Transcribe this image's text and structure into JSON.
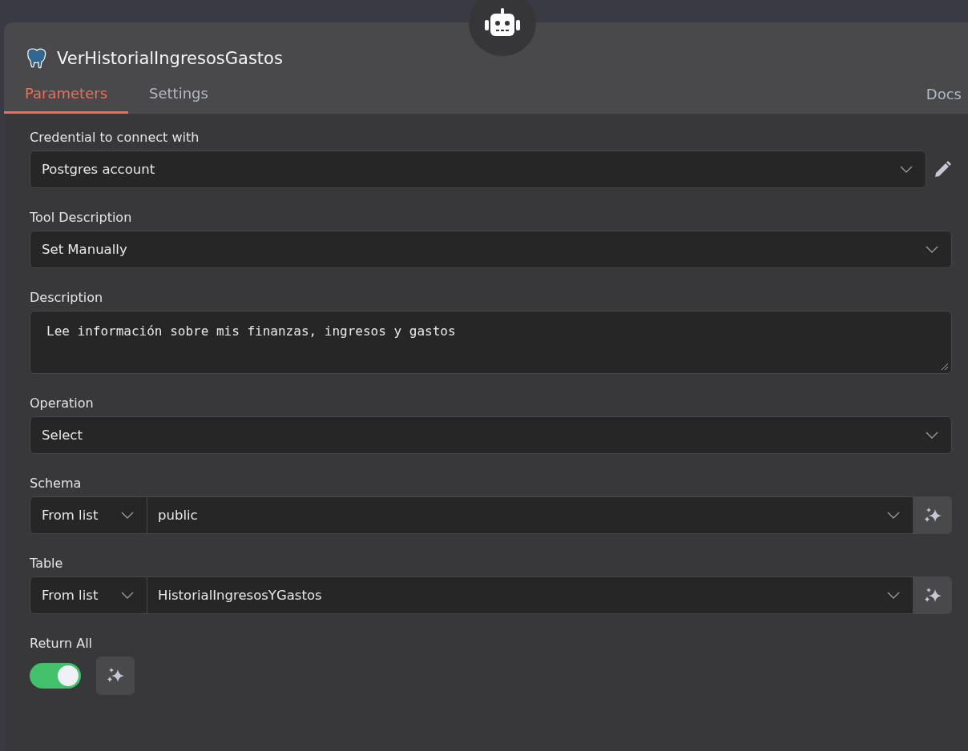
{
  "node": {
    "title": "VerHistorialIngresosGastos"
  },
  "tabs": [
    {
      "label": "Parameters",
      "selected": true
    },
    {
      "label": "Settings",
      "selected": false
    }
  ],
  "docs_link": "Docs",
  "parameters": [
    {
      "kind": "select",
      "label": "Credential to connect with",
      "value": "Postgres account",
      "editable": true
    },
    {
      "kind": "select",
      "label": "Tool Description",
      "value": "Set Manually",
      "editable": false
    },
    {
      "kind": "textarea",
      "label": "Description",
      "value": "Lee información sobre mis finanzas, ingresos y gastos"
    },
    {
      "kind": "select",
      "label": "Operation",
      "value": "Select",
      "editable": false
    },
    {
      "kind": "locator",
      "label": "Schema",
      "mode": "From list",
      "value": "public"
    },
    {
      "kind": "locator",
      "label": "Table",
      "mode": "From list",
      "value": "HistorialIngresosYGastos"
    },
    {
      "kind": "toggle",
      "label": "Return All",
      "on": true
    }
  ]
}
